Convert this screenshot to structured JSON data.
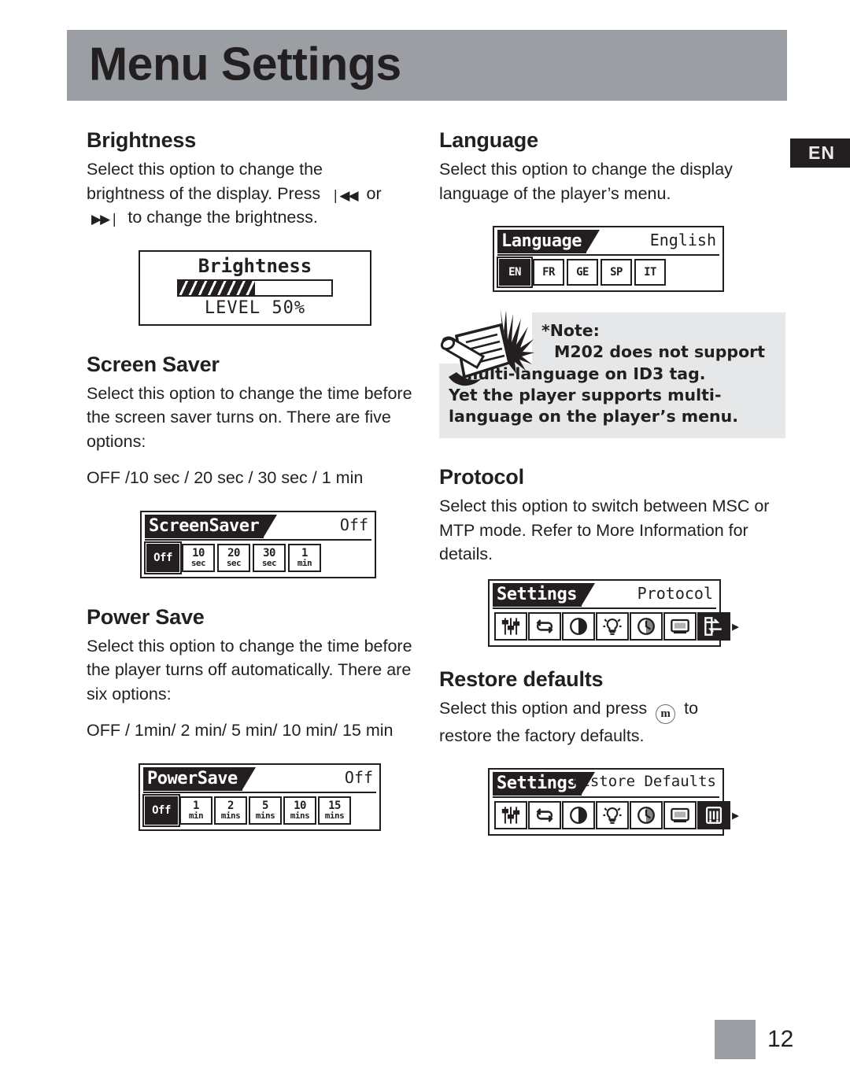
{
  "header": {
    "title": "Menu Settings"
  },
  "lang_badge": {
    "label": "EN"
  },
  "footer": {
    "page_number": "12"
  },
  "left_column": {
    "brightness": {
      "heading": "Brightness",
      "body_line1": "Select this option to change the",
      "body_line2a": "brightness of the display. Press",
      "prev_icon": "❘◀◀",
      "body_line2b": "or",
      "next_icon": "▶▶❘",
      "body_line3": "to change the brightness.",
      "lcd": {
        "title": "Brightness",
        "level_text": "LEVEL 50%",
        "level_percent": 50
      }
    },
    "screen_saver": {
      "heading": "Screen Saver",
      "body": "Select this option to change the time before the screen saver turns on. There are five options:",
      "options_text": "OFF /10 sec / 20 sec / 30 sec / 1 min",
      "lcd": {
        "tab": "ScreenSaver",
        "value": "Off",
        "cells": [
          {
            "big": "Off",
            "sub": "",
            "selected": true
          },
          {
            "big": "10",
            "sub": "sec",
            "selected": false
          },
          {
            "big": "20",
            "sub": "sec",
            "selected": false
          },
          {
            "big": "30",
            "sub": "sec",
            "selected": false
          },
          {
            "big": "1",
            "sub": "min",
            "selected": false
          }
        ]
      }
    },
    "power_save": {
      "heading": "Power Save",
      "body": "Select this option to change the time before the player turns off automatically. There are six options:",
      "options_text": "OFF / 1min/ 2 min/ 5 min/ 10 min/ 15 min",
      "lcd": {
        "tab": "PowerSave",
        "value": "Off",
        "cells": [
          {
            "big": "Off",
            "sub": "",
            "selected": true
          },
          {
            "big": "1",
            "sub": "min",
            "selected": false
          },
          {
            "big": "2",
            "sub": "mins",
            "selected": false
          },
          {
            "big": "5",
            "sub": "mins",
            "selected": false
          },
          {
            "big": "10",
            "sub": "mins",
            "selected": false
          },
          {
            "big": "15",
            "sub": "mins",
            "selected": false
          }
        ]
      }
    }
  },
  "right_column": {
    "language": {
      "heading": "Language",
      "body": "Select this option to change the display language of the player’s menu.",
      "lcd": {
        "tab": "Language",
        "value": "English",
        "cells": [
          {
            "big": "EN",
            "selected": true
          },
          {
            "big": "FR",
            "selected": false
          },
          {
            "big": "GE",
            "selected": false
          },
          {
            "big": "SP",
            "selected": false
          },
          {
            "big": "IT",
            "selected": false
          }
        ]
      }
    },
    "note": {
      "label": "*Note:",
      "line1": "M202 does not support",
      "line2": "multi-language on ID3 tag.",
      "line3": "Yet the player supports multi-",
      "line4": "language on the player’s menu.",
      "icon": "note-pencil-icon",
      "background": "#e6e7e8"
    },
    "protocol": {
      "heading": "Protocol",
      "body": "Select this option to switch between MSC or MTP mode. Refer to More Information for details.",
      "lcd": {
        "tab": "Settings",
        "value": "Protocol",
        "icons": [
          {
            "name": "equalizer-icon",
            "selected": false
          },
          {
            "name": "repeat-icon",
            "selected": false
          },
          {
            "name": "contrast-icon",
            "selected": false
          },
          {
            "name": "backlight-bulb-icon",
            "selected": false
          },
          {
            "name": "clock-icon",
            "selected": false
          },
          {
            "name": "screensaver-icon",
            "selected": false
          },
          {
            "name": "protocol-icon",
            "selected": true
          }
        ],
        "scroll_arrow": "▶"
      }
    },
    "restore_defaults": {
      "heading": "Restore defaults",
      "body_a": "Select this option and press",
      "menu_button": "m",
      "body_b": "to",
      "body_c": "restore the factory defaults.",
      "lcd": {
        "tab": "Settings",
        "value": "Restore Defaults",
        "icons": [
          {
            "name": "equalizer-icon",
            "selected": false
          },
          {
            "name": "repeat-icon",
            "selected": false
          },
          {
            "name": "contrast-icon",
            "selected": false
          },
          {
            "name": "backlight-bulb-icon",
            "selected": false
          },
          {
            "name": "clock-icon",
            "selected": false
          },
          {
            "name": "screensaver-icon",
            "selected": false
          },
          {
            "name": "restore-defaults-icon",
            "selected": true
          }
        ],
        "scroll_arrow": "▶"
      }
    }
  },
  "colors": {
    "header_gray": "#9b9ea3",
    "note_gray": "#e6e7e8",
    "ink": "#231f20"
  }
}
